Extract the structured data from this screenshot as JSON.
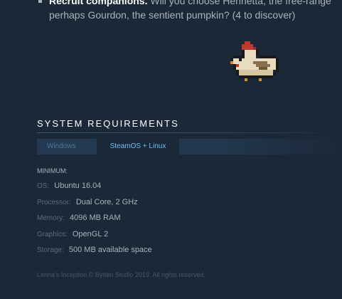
{
  "description": {
    "bullet_bold": "Recruit companions.",
    "bullet_rest": " Will you choose Henrietta, the free-range",
    "line2": "perhaps Gourdon, the sentient pumpkin? (4 to discover)"
  },
  "sysreq": {
    "title": "SYSTEM REQUIREMENTS",
    "tabs": [
      {
        "label": "Windows"
      },
      {
        "label": "SteamOS + Linux"
      }
    ],
    "minimum_label": "MINIMUM:",
    "rows": [
      {
        "label": "OS:",
        "value": "Ubuntu 16.04"
      },
      {
        "label": "Processor:",
        "value": "Dual Core, 2 GHz"
      },
      {
        "label": "Memory:",
        "value": "4096 MB RAM"
      },
      {
        "label": "Graphics:",
        "value": "OpenGL 2"
      },
      {
        "label": "Storage:",
        "value": "500 MB available space"
      }
    ]
  },
  "footer": {
    "legal": "Lenna's Inception © Bytten Studio 2019. All rights reserved."
  }
}
